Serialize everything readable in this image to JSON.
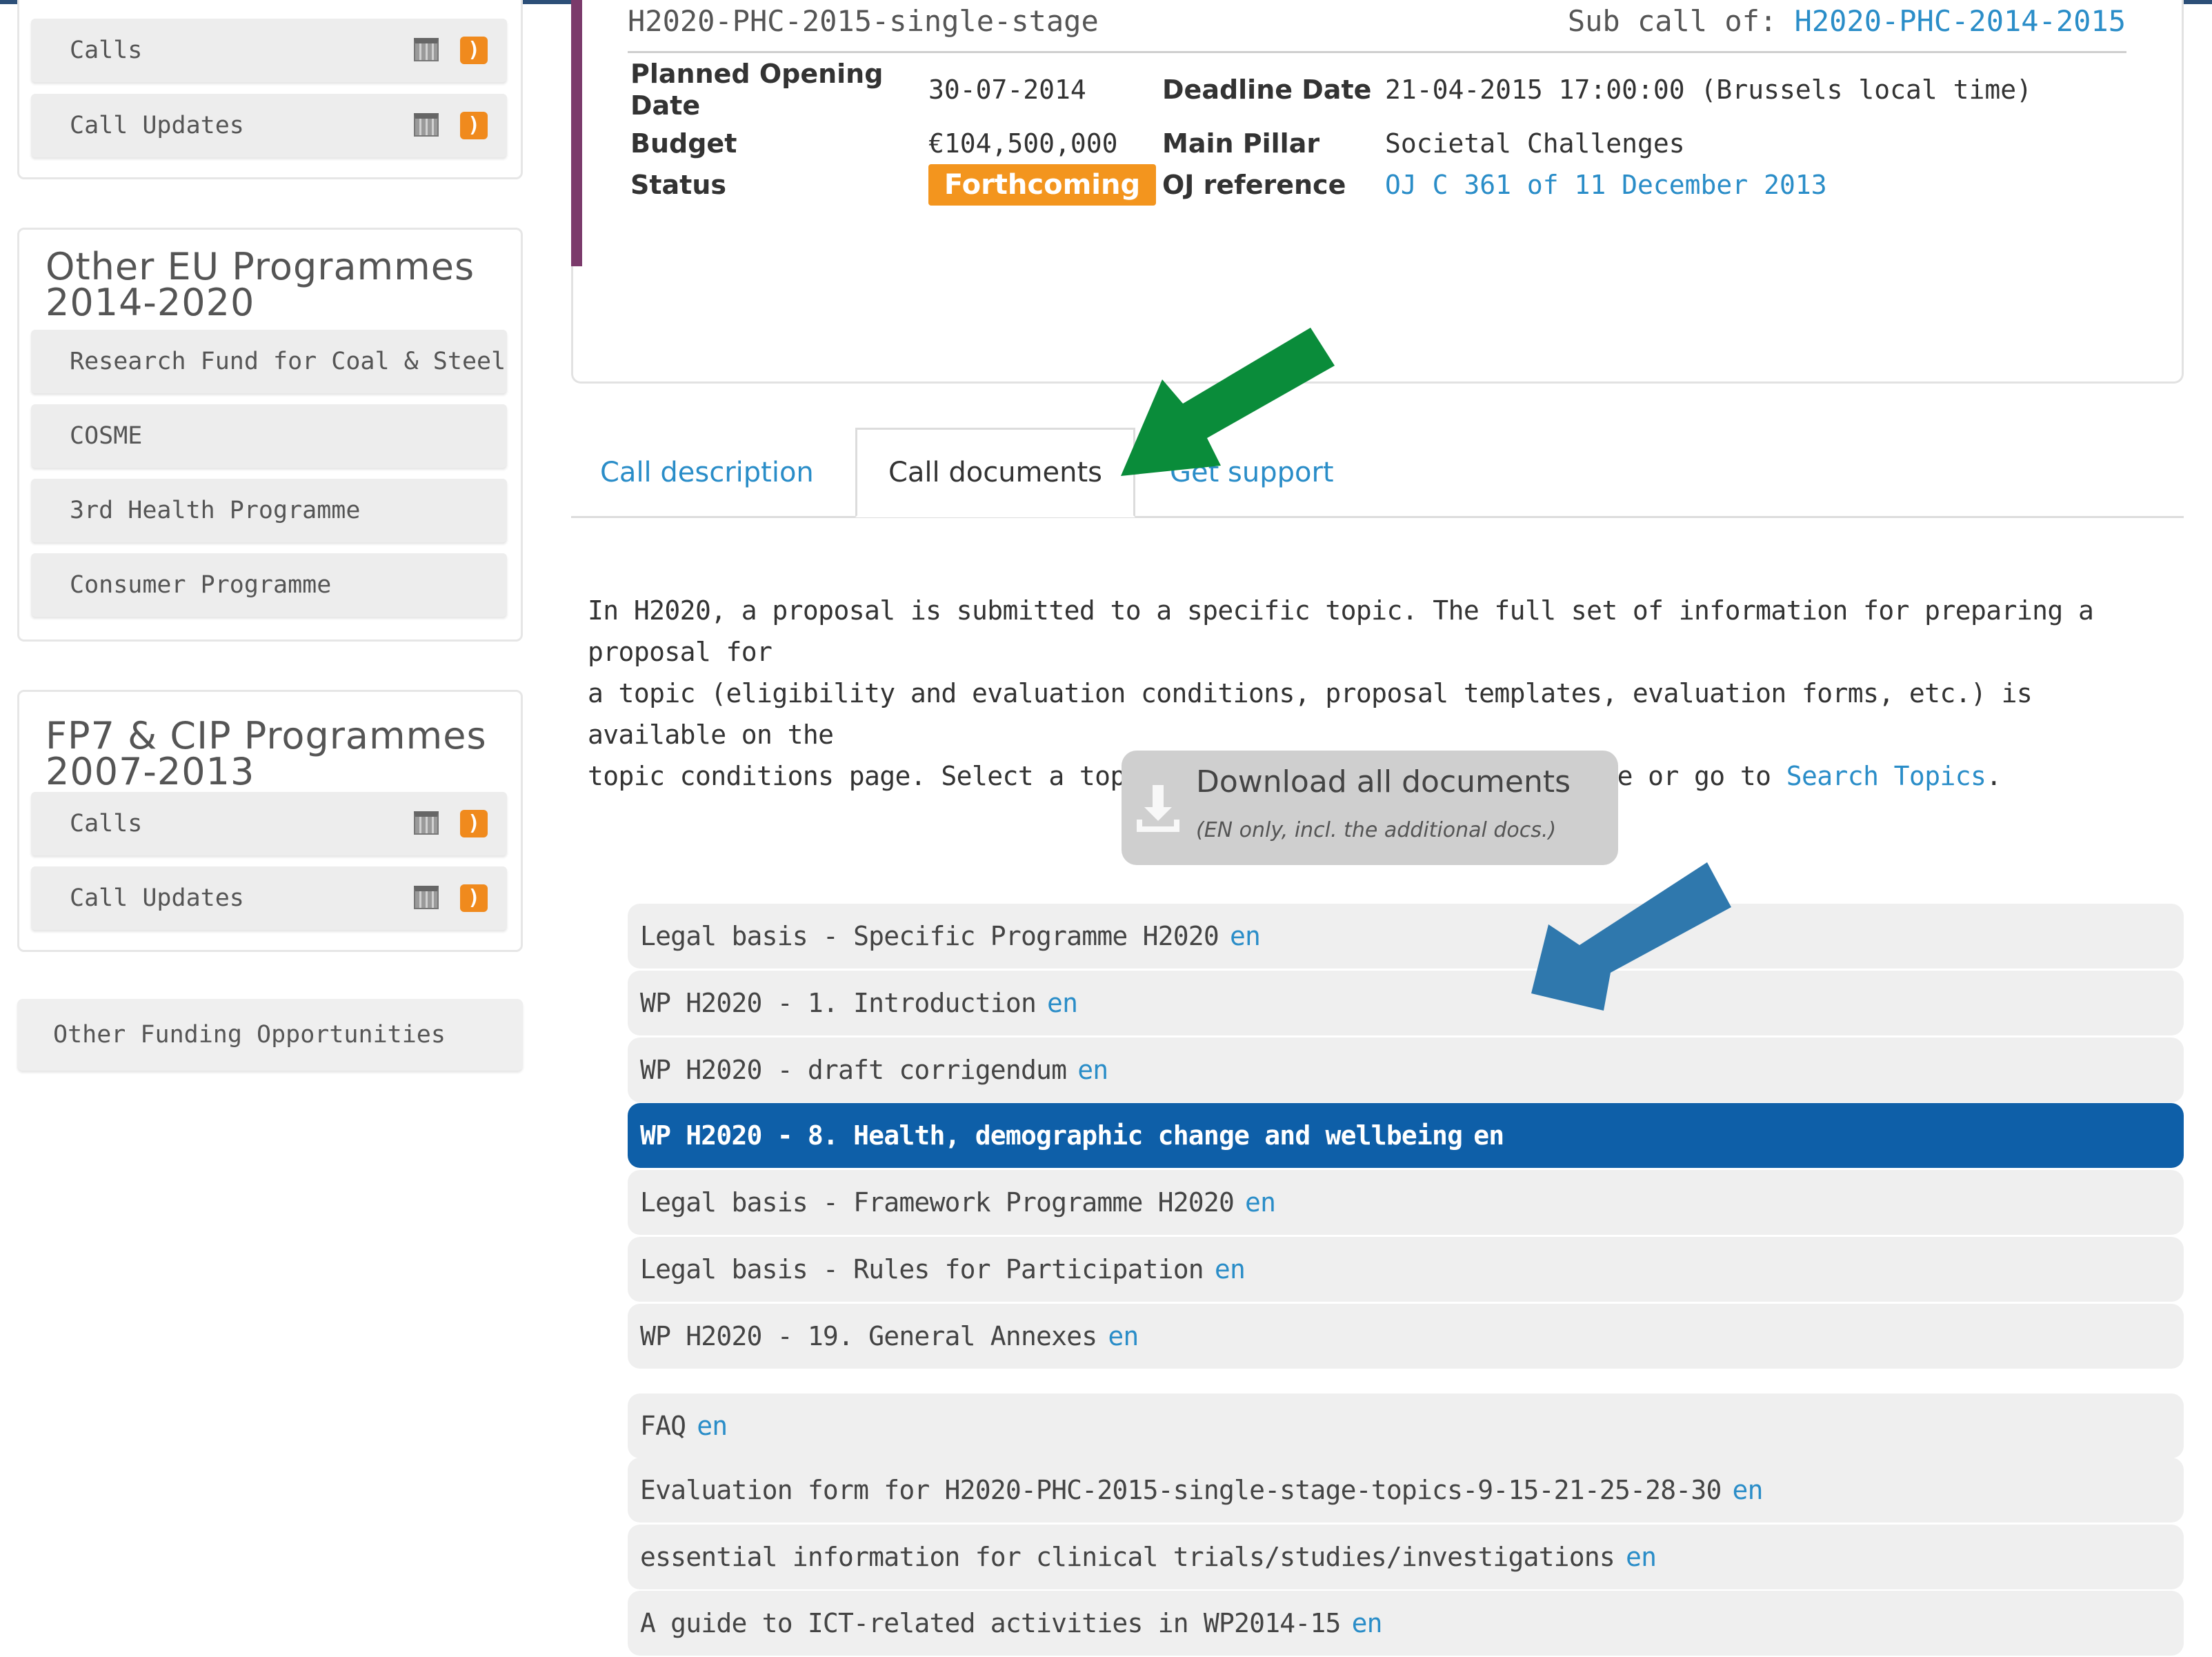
{
  "sidebar": {
    "top_panel": {
      "items": [
        {
          "label": "Calls"
        },
        {
          "label": "Call Updates"
        }
      ]
    },
    "other_eu": {
      "title_line1": "Other EU Programmes",
      "title_line2": "2014-2020",
      "items": [
        {
          "label": "Research Fund for Coal & Steel"
        },
        {
          "label": "COSME"
        },
        {
          "label": "3rd Health Programme"
        },
        {
          "label": "Consumer Programme"
        }
      ]
    },
    "fp7": {
      "title_line1": "FP7 & CIP Programmes",
      "title_line2": "2007-2013",
      "items": [
        {
          "label": "Calls"
        },
        {
          "label": "Call Updates"
        }
      ]
    },
    "other_funding": "Other Funding Opportunities",
    "icons": [
      "calendar-icon",
      "rss-icon"
    ]
  },
  "call": {
    "id": "H2020-PHC-2015-single-stage",
    "subcall_prefix": "Sub call of:",
    "subcall_link": "H2020-PHC-2014-2015",
    "opening_label_1": "Planned Opening",
    "opening_label_2": "Date",
    "opening_value": "30-07-2014",
    "deadline_label": "Deadline Date",
    "deadline_value": "21-04-2015 17:00:00 (Brussels local time)",
    "budget_label": "Budget",
    "budget_value": "€104,500,000",
    "pillar_label": "Main Pillar",
    "pillar_value": "Societal Challenges",
    "status_label": "Status",
    "status_value": "Forthcoming",
    "oj_label": "OJ reference",
    "oj_value": "OJ C 361 of 11 December 2013",
    "status_color": "#f3951e"
  },
  "tabs": [
    {
      "label": "Call description"
    },
    {
      "label": "Call documents"
    },
    {
      "label": "Get support"
    }
  ],
  "description": {
    "line1": "In H2020, a proposal is submitted to a specific topic. The full set of information for preparing a proposal for",
    "line2": "a topic (eligibility and evaluation conditions, proposal templates, evaluation forms, etc.) is available on the",
    "line3_prefix": "topic conditions page. Select a topic from the call description page or go to",
    "line3_link": "Search Topics",
    "line3_suffix": "."
  },
  "download": {
    "title": "Download all documents",
    "subtitle": "(EN only, incl. the additional docs.)"
  },
  "documents": [
    {
      "title": "Legal basis - Specific Programme H2020",
      "lang": "en"
    },
    {
      "title": "WP H2020 - 1. Introduction",
      "lang": "en"
    },
    {
      "title": "WP H2020 - draft corrigendum",
      "lang": "en"
    },
    {
      "title": "WP H2020 - 8. Health, demographic change and wellbeing",
      "lang": "en"
    },
    {
      "title": "Legal basis - Framework Programme H2020",
      "lang": "en"
    },
    {
      "title": "Legal basis - Rules for Participation",
      "lang": "en"
    },
    {
      "title": "WP H2020 - 19. General Annexes",
      "lang": "en"
    }
  ],
  "additional_documents": [
    {
      "title": "FAQ",
      "lang": "en"
    },
    {
      "title": "Evaluation form for H2020-PHC-2015-single-stage-topics-9-15-21-25-28-30",
      "lang": "en"
    },
    {
      "title": "essential information for clinical trials/studies/investigations",
      "lang": "en"
    },
    {
      "title": "A guide to ICT-related activities in WP2014-15",
      "lang": "en"
    }
  ],
  "colors": {
    "link": "#2a8dc8",
    "selected_row": "#0e5fa8",
    "green_arrow": "#0a8c3a",
    "blue_arrow": "#2f78ad"
  }
}
